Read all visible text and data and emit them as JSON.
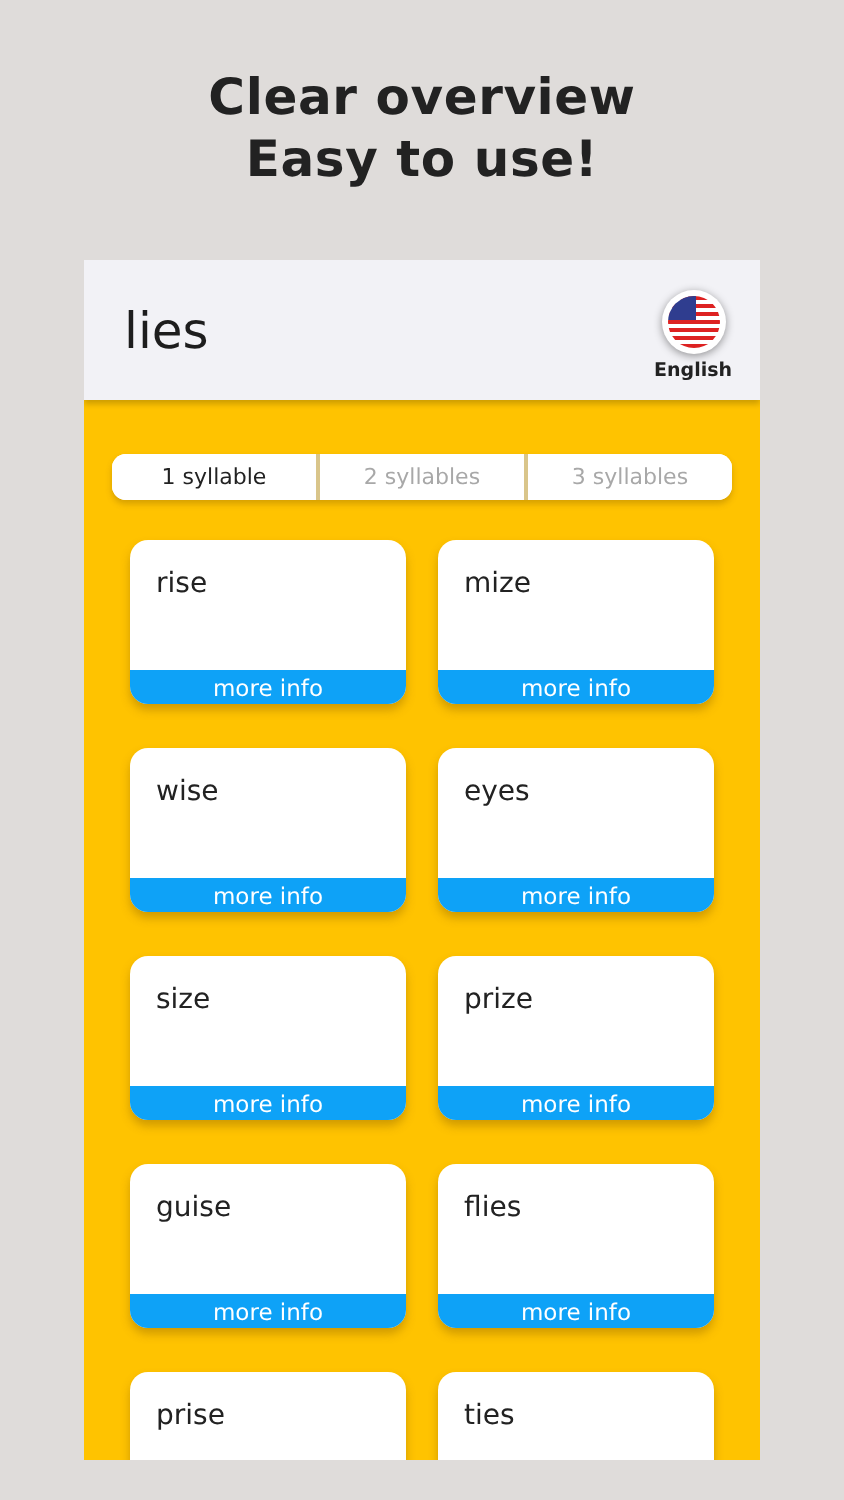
{
  "headline": [
    "Clear overview",
    "Easy to use!"
  ],
  "header": {
    "title": "lies",
    "language": "English"
  },
  "tabs": [
    {
      "label": "1 syllable",
      "selected": true
    },
    {
      "label": "2 syllables",
      "selected": false
    },
    {
      "label": "3 syllables",
      "selected": false
    }
  ],
  "cards": [
    {
      "word": "rise",
      "action": "more info"
    },
    {
      "word": "mize",
      "action": "more info"
    },
    {
      "word": "wise",
      "action": "more info"
    },
    {
      "word": "eyes",
      "action": "more info"
    },
    {
      "word": "size",
      "action": "more info"
    },
    {
      "word": "prize",
      "action": "more info"
    },
    {
      "word": "guise",
      "action": "more info"
    },
    {
      "word": "flies",
      "action": "more info"
    },
    {
      "word": "prise"
    },
    {
      "word": "ties"
    }
  ]
}
